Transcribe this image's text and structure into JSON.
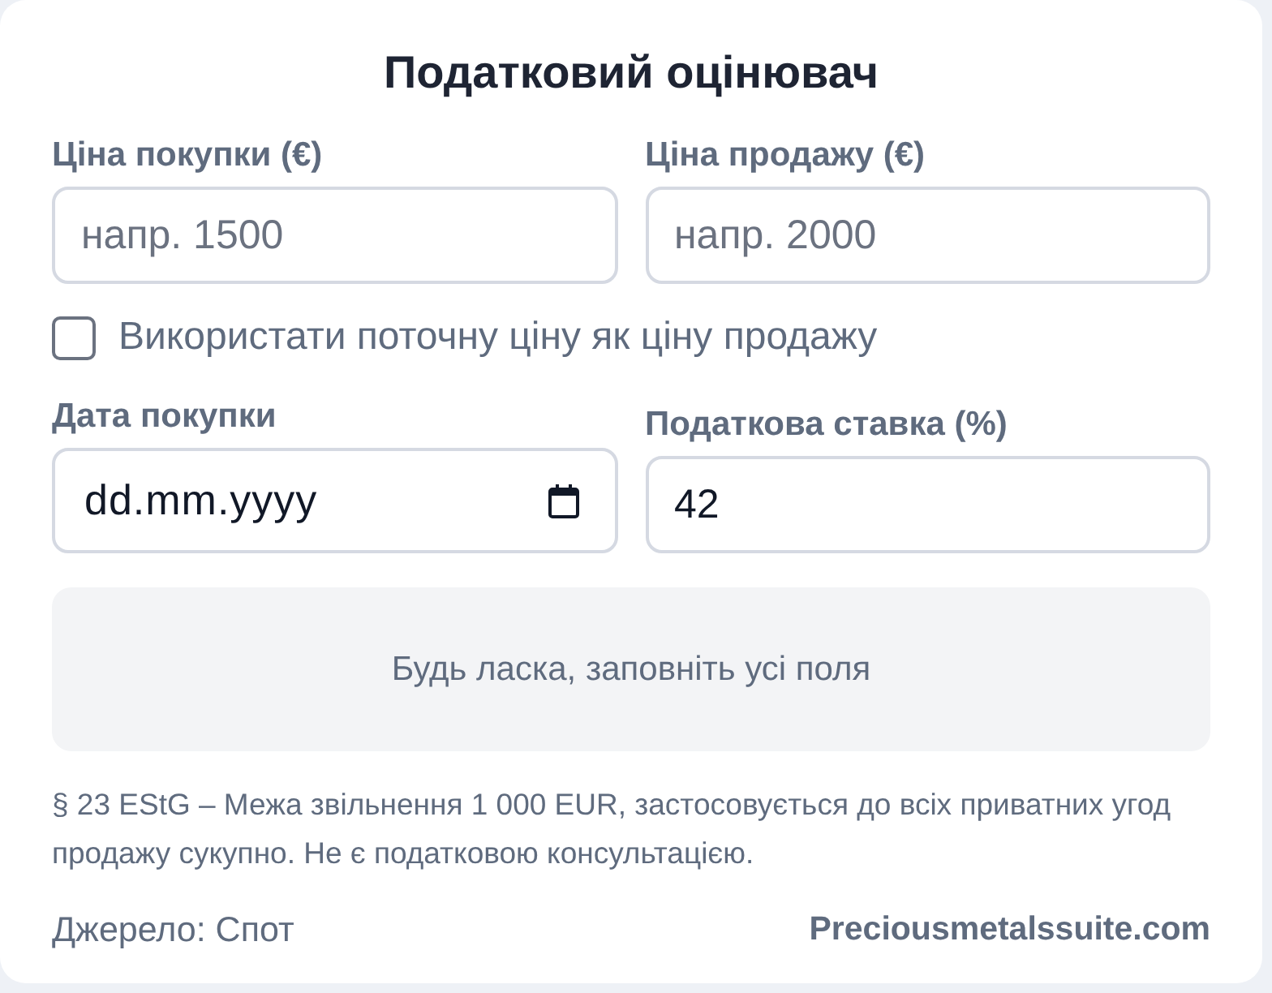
{
  "title": "Податковий оцінювач",
  "price_fields": [
    {
      "label": "Ціна покупки (€)",
      "kind": "number",
      "placeholder": "напр. 1500"
    },
    {
      "label": "Ціна продажу (€)",
      "kind": "number",
      "placeholder": "напр. 2000"
    }
  ],
  "use_current_price": {
    "label": "Використати поточну ціну як ціну продажу",
    "checked": false
  },
  "detail_fields": [
    {
      "label": "Дата покупки",
      "kind": "date",
      "placeholder": "dd.mm.yyyy"
    },
    {
      "label": "Податкова ставка (%)",
      "kind": "number",
      "value": "42"
    }
  ],
  "result": {
    "message": "Будь ласка, заповніть усі поля"
  },
  "note": "§ 23 EStG – Межа звільнення 1 000 EUR, застосовується до всіх приватних угод продажу сукупно. Не є податковою консультацією.",
  "footer": {
    "source": "Джерело: Спот",
    "brand": "Preciousmetalssuite.com"
  }
}
